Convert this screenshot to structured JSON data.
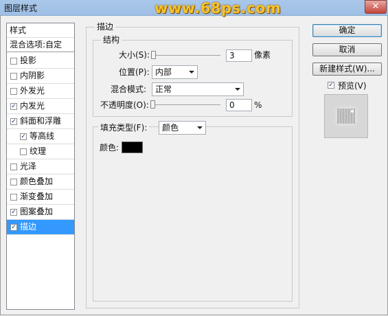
{
  "window": {
    "title": "图层样式",
    "watermark": "www.68ps.com",
    "close_glyph": "✕"
  },
  "styles_list": {
    "header": "样式",
    "blending": "混合选项:自定",
    "items": [
      {
        "label": "投影",
        "checked": false,
        "indent": false
      },
      {
        "label": "内阴影",
        "checked": false,
        "indent": false
      },
      {
        "label": "外发光",
        "checked": false,
        "indent": false
      },
      {
        "label": "内发光",
        "checked": true,
        "indent": false
      },
      {
        "label": "斜面和浮雕",
        "checked": true,
        "indent": false
      },
      {
        "label": "等高线",
        "checked": true,
        "indent": true
      },
      {
        "label": "纹理",
        "checked": false,
        "indent": true
      },
      {
        "label": "光泽",
        "checked": false,
        "indent": false
      },
      {
        "label": "颜色叠加",
        "checked": false,
        "indent": false
      },
      {
        "label": "渐变叠加",
        "checked": false,
        "indent": false
      },
      {
        "label": "图案叠加",
        "checked": true,
        "indent": false
      },
      {
        "label": "描边",
        "checked": true,
        "indent": false,
        "selected": true
      }
    ]
  },
  "stroke": {
    "title": "描边",
    "structure": {
      "title": "结构",
      "size_label": "大小(S):",
      "size_value": "3",
      "size_unit": "像素",
      "position_label": "位置(P):",
      "position_value": "内部",
      "blend_label": "混合模式:",
      "blend_value": "正常",
      "opacity_label": "不透明度(O):",
      "opacity_value": "0",
      "opacity_unit": "%"
    },
    "fill": {
      "type_label": "填充类型(F):",
      "type_value": "颜色",
      "color_label": "颜色:",
      "color_value": "#000000"
    }
  },
  "buttons": {
    "ok": "确定",
    "cancel": "取消",
    "new_style": "新建样式(W)...",
    "preview_label": "预览(V)",
    "preview_checked": true
  },
  "colors": {
    "selection": "#3399ff",
    "title_bar": "#a9c7e9",
    "watermark": "#f7c22a"
  },
  "icons": {
    "check": "check-icon",
    "dropdown": "chevron-down-icon",
    "close": "close-icon"
  }
}
